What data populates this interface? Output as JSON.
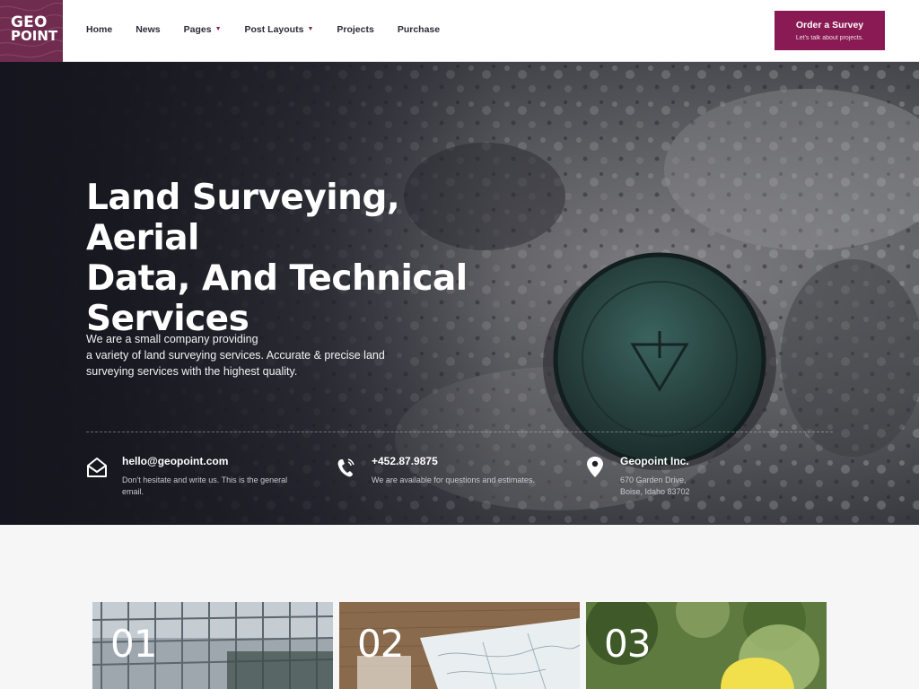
{
  "brand": {
    "logo_line1": "GEO",
    "logo_line2": "POINT",
    "accent": "#8a1a53",
    "logo_bg": "#6f2c4f"
  },
  "nav": {
    "items": [
      {
        "label": "Home",
        "has_dropdown": false
      },
      {
        "label": "News",
        "has_dropdown": false
      },
      {
        "label": "Pages",
        "has_dropdown": true
      },
      {
        "label": "Post Layouts",
        "has_dropdown": true
      },
      {
        "label": "Projects",
        "has_dropdown": false
      },
      {
        "label": "Purchase",
        "has_dropdown": false
      }
    ],
    "caret": "▼"
  },
  "cta": {
    "title": "Order a Survey",
    "subtitle": "Let's talk about projects."
  },
  "hero": {
    "title_lines": [
      "Land Surveying, Aerial",
      "Data, And Technical",
      "Services"
    ],
    "description_lines": [
      "We are a small company providing",
      "a variety of land surveying services. Accurate & precise land",
      "surveying services with the highest quality."
    ]
  },
  "contacts": [
    {
      "icon": "envelope-icon",
      "title": "hello@geopoint.com",
      "lines": [
        "Don't hesitate and write us. This is the general",
        "email."
      ]
    },
    {
      "icon": "phone-icon",
      "title": "+452.87.9875",
      "lines": [
        "We are available for questions and estimates."
      ]
    },
    {
      "icon": "location-pin-icon",
      "title": "Geopoint Inc.",
      "lines": [
        "670 Garden Drive,",
        "Boise, Idaho 83702"
      ]
    }
  ],
  "cards": [
    {
      "number": "01"
    },
    {
      "number": "02"
    },
    {
      "number": "03"
    }
  ]
}
